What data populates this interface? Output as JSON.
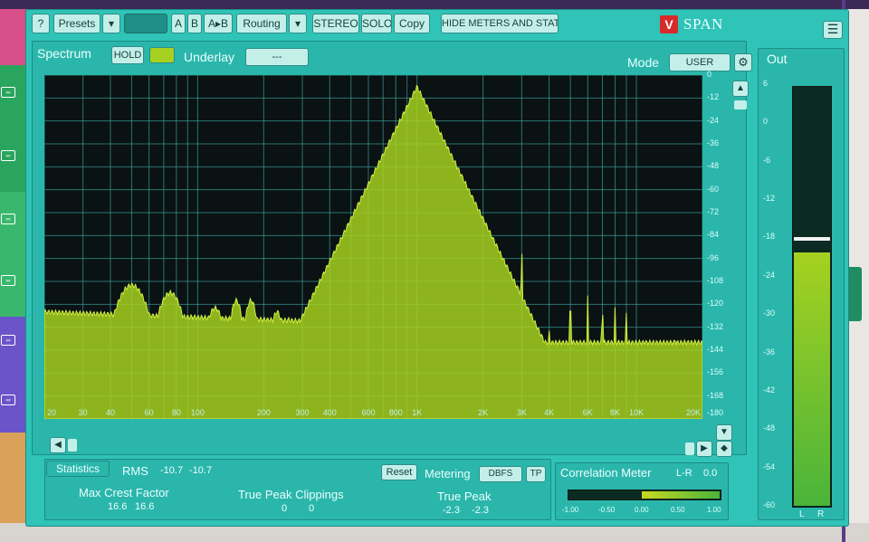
{
  "host": {
    "track_buttons": [
      "▭",
      "▭",
      "▭",
      "▭",
      "▭",
      "▭",
      "▭"
    ]
  },
  "toolbar": {
    "help": "?",
    "presets": "Presets",
    "presets_arrow": "▾",
    "a": "A",
    "b": "B",
    "a_to_b": "A▸B",
    "routing": "Routing",
    "routing_arrow": "▾",
    "stereo": "STEREO",
    "solo": "SOLO",
    "copy": "Copy",
    "hide_meters": "HIDE METERS AND STATS",
    "brand": "SPAN",
    "brand_logo": "V"
  },
  "spectrum": {
    "label": "Spectrum",
    "hold": "HOLD",
    "underlay_label": "Underlay",
    "underlay_value": "---",
    "mode_label": "Mode",
    "mode_value": "USER",
    "db_ticks": [
      "0",
      "-12",
      "-24",
      "-36",
      "-48",
      "-60",
      "-72",
      "-84",
      "-96",
      "-108",
      "-120",
      "-132",
      "-144",
      "-156",
      "-168",
      "-180"
    ],
    "freq_ticks": [
      {
        "label": "20",
        "hz": 20
      },
      {
        "label": "30",
        "hz": 30
      },
      {
        "label": "40",
        "hz": 40
      },
      {
        "label": "60",
        "hz": 60
      },
      {
        "label": "80",
        "hz": 80
      },
      {
        "label": "100",
        "hz": 100
      },
      {
        "label": "200",
        "hz": 200
      },
      {
        "label": "300",
        "hz": 300
      },
      {
        "label": "400",
        "hz": 400
      },
      {
        "label": "600",
        "hz": 600
      },
      {
        "label": "800",
        "hz": 800
      },
      {
        "label": "1K",
        "hz": 1000
      },
      {
        "label": "2K",
        "hz": 2000
      },
      {
        "label": "3K",
        "hz": 3000
      },
      {
        "label": "4K",
        "hz": 4000
      },
      {
        "label": "6K",
        "hz": 6000
      },
      {
        "label": "8K",
        "hz": 8000
      },
      {
        "label": "10K",
        "hz": 10000
      },
      {
        "label": "20K",
        "hz": 20000
      }
    ],
    "x_range_hz": [
      20,
      20000
    ],
    "y_range_db": [
      -180,
      0
    ],
    "trace_color": "#a6d120",
    "grid_color": "#3c9d98"
  },
  "out_meter": {
    "label": "Out",
    "ticks": [
      "6",
      "0",
      "-6",
      "-12",
      "-18",
      "-24",
      "-30",
      "-36",
      "-42",
      "-48",
      "-54",
      "-60"
    ],
    "level_db": -20,
    "peak_hold_db": -18,
    "channels": [
      "L",
      "R"
    ]
  },
  "statistics": {
    "label": "Statistics",
    "rms_label": "RMS",
    "rms_l": "-10.7",
    "rms_r": "-10.7",
    "reset": "Reset",
    "metering_label": "Metering",
    "metering_value": "DBFS",
    "tp": "TP",
    "max_crest_label": "Max Crest Factor",
    "max_crest_l": "16.6",
    "max_crest_r": "16.6",
    "tp_clip_label": "True Peak Clippings",
    "tp_clip_l": "0",
    "tp_clip_r": "0",
    "true_peak_label": "True Peak",
    "true_peak_l": "-2.3",
    "true_peak_r": "-2.3"
  },
  "correlation": {
    "label": "Correlation Meter",
    "mode": "L-R",
    "value": "0.0",
    "ticks": [
      "-1.00",
      "-0.50",
      "0.00",
      "0.50",
      "1.00"
    ]
  },
  "colors": {
    "panel": "#30c3b7",
    "dark": "#0a1213",
    "accent": "#a6d120",
    "brand_red": "#d82a2a"
  }
}
